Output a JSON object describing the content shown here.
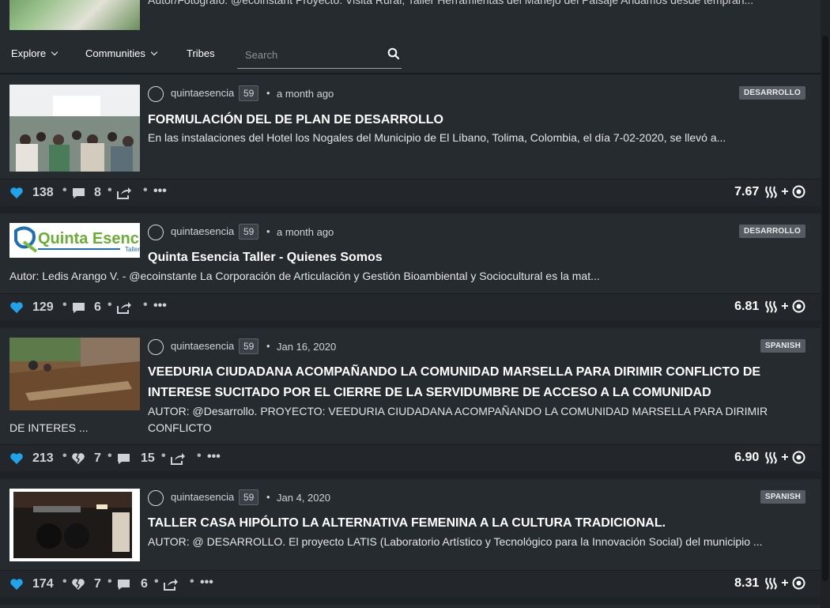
{
  "top_partial": {
    "description": "Autor/Fotógrafo: @ecoinstant Proyecto: Visita Rural, Taller Herramientas del Manejo del Paisaje Andamos desde tempran..."
  },
  "nav": {
    "explore": "Explore",
    "communities": "Communities",
    "tribes": "Tribes",
    "search_placeholder": "Search"
  },
  "posts": [
    {
      "author": "quintaesencia",
      "reputation": "59",
      "time": "a month ago",
      "tag": "DESARROLLO",
      "title": "FORMULACIÓN DEL DE PLAN DE DESARROLLO",
      "description": "En las instalaciones del Hotel los Nogales del Municipio de El Líbano, Tolima, Colombia, el día 7-02-2020, se llevó a...",
      "votes": "138",
      "comments": "8",
      "payout": "7.67"
    },
    {
      "author": "quintaesencia",
      "reputation": "59",
      "time": "a month ago",
      "tag": "DESARROLLO",
      "title": "Quinta Esencia Taller - Quienes Somos",
      "description": "Autor: Ledis Arango V. - @ecoinstante La Corporación de Articulación y Gestión Bioambiental y Sociocultural es la mat...",
      "votes": "129",
      "comments": "6",
      "payout": "6.81",
      "logo_text": "Quinta Esencia",
      "logo_sub": "Taller"
    },
    {
      "author": "quintaesencia",
      "reputation": "59",
      "time": "Jan 16, 2020",
      "tag": "SPANISH",
      "title_line1": "VEEDURIA CIUDADANA ACOMPAÑANDO LA COMUNIDAD MARSELLA PARA DIRIMIR CONFLICTO DE",
      "title_line2": "INTERESE SUCITADO POR EL CIERRE DE LA SERVIDUMBRE DE ACCESO A LA COMUNIDAD",
      "description_line1": "AUTOR: @Desarrollo. PROYECTO: VEEDURIA CIUDADANA ACOMPAÑANDO LA COMUNIDAD MARSELLA PARA DIRIMIR CONFLICTO",
      "description_line2": "DE INTERES ...",
      "votes": "213",
      "downvotes": "7",
      "comments": "15",
      "payout": "6.90"
    },
    {
      "author": "quintaesencia",
      "reputation": "59",
      "time": "Jan 4, 2020",
      "tag": "SPANISH",
      "title": "TALLER CASA HIPÓLITO LA ALTERNATIVA FEMENINA A LA CULTURA TRADICIONAL.",
      "description": "AUTOR: @ DESARROLLO. El proyecto LATIS (Laboratorio Artístico y Tecnológico para la Innovación Social) del municipio ...",
      "votes": "174",
      "downvotes": "7",
      "comments": "6",
      "payout": "8.31"
    }
  ],
  "payout_plus": "+",
  "icons": [
    "heart-icon",
    "broken-heart-icon",
    "comment-icon",
    "reblog-icon",
    "more-icon",
    "steem-icon",
    "steem-engine-icon",
    "search-icon"
  ],
  "colors": {
    "vote_blue": "#1fa3ea",
    "card_bg": "#262b30",
    "page_bg": "#1f2326"
  }
}
